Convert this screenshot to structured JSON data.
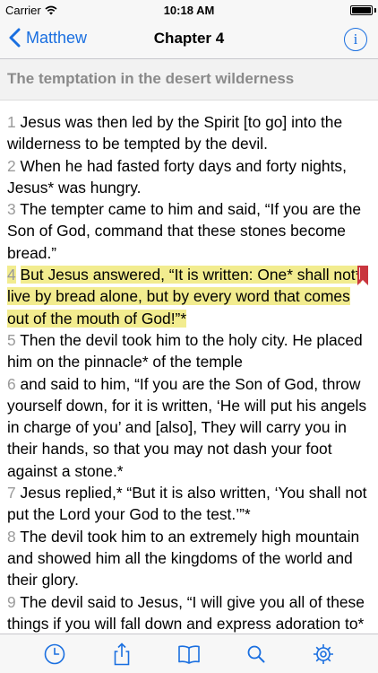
{
  "status_bar": {
    "carrier": "Carrier",
    "time": "10:18 AM"
  },
  "nav_bar": {
    "back_label": "Matthew",
    "title": "Chapter 4",
    "info_glyph": "i"
  },
  "section": {
    "title": "The temptation in the desert wilderness"
  },
  "verses": [
    {
      "num": "1",
      "text": "Jesus was then led by the Spirit [to go] into the wilderness to be tempted by the devil."
    },
    {
      "num": "2",
      "text": "When he had fasted forty days and forty nights, Jesus* was hungry."
    },
    {
      "num": "3",
      "text": "The tempter came to him and said, “If you are the Son of God, command that these stones become bread.”"
    },
    {
      "num": "4",
      "text": "But Jesus answered, “It is written: One* shall not* live by bread alone, but by every word that comes out of the mouth of God!”*"
    },
    {
      "num": "5",
      "text": "Then the devil took him to the holy city. He placed him on the pinnacle* of the temple"
    },
    {
      "num": "6",
      "text": "and said to him, “If you are the Son of God, throw yourself down, for it is written, ‘He will put his angels in charge of you’ and [also], They will carry you in their hands, so that you may not dash your foot against a stone.*"
    },
    {
      "num": "7",
      "text": "Jesus replied,* “But it is also written, ‘You shall not put the Lord your God to the test.’”*"
    },
    {
      "num": "8",
      "text": "The devil took him to an extremely high mountain and showed him all the kingdoms of the world and their glory."
    },
    {
      "num": "9",
      "text": "The devil said to Jesus, “I will give you all of these things if you will fall down and express adoration to*"
    }
  ],
  "highlighted_verse": "4",
  "colors": {
    "accent": "#1a6fe0",
    "highlight": "#f2ec8f",
    "bookmark": "#c9363e",
    "verse_number": "#9a9a9a"
  },
  "tab_bar": {
    "items": [
      "history-icon",
      "share-icon",
      "book-icon",
      "search-icon",
      "settings-icon"
    ]
  }
}
